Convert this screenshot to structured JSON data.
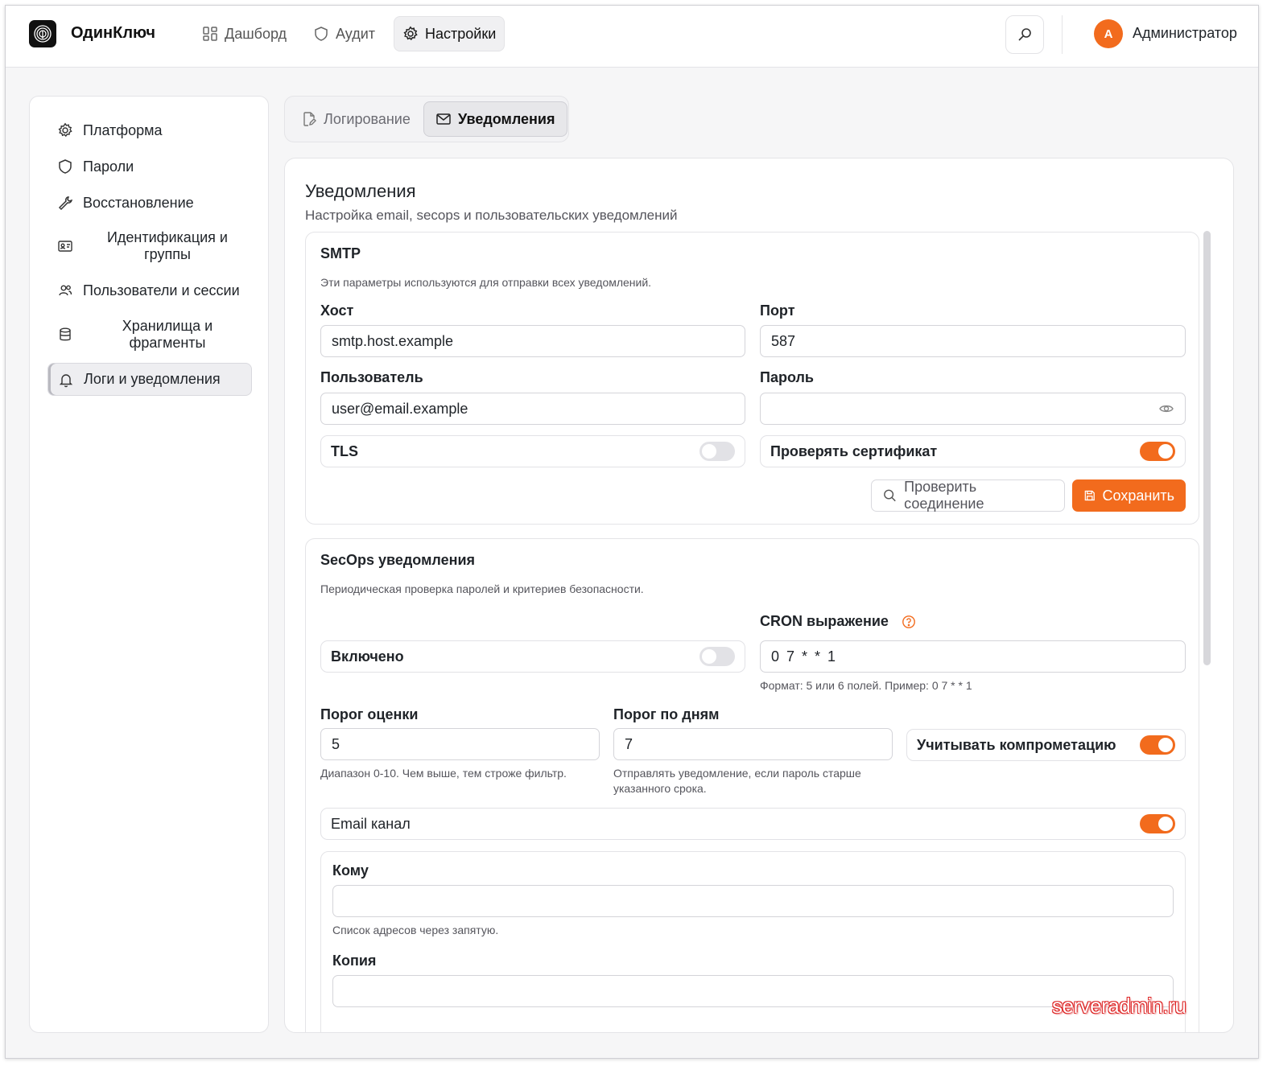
{
  "app": {
    "name": "ОдинКлюч",
    "nav": [
      {
        "label": "Дашборд",
        "icon": "dashboard-grid-icon"
      },
      {
        "label": "Аудит",
        "icon": "shield-icon"
      },
      {
        "label": "Настройки",
        "icon": "gear-icon",
        "active": true
      }
    ],
    "user": {
      "initial": "A",
      "name": "Администратор"
    }
  },
  "sidebar": {
    "items": [
      {
        "label": "Платформа",
        "icon": "gear-icon"
      },
      {
        "label": "Пароли",
        "icon": "shield-icon"
      },
      {
        "label": "Восстановление",
        "icon": "wrench-icon"
      },
      {
        "label": "Идентификация и группы",
        "icon": "id-card-icon"
      },
      {
        "label": "Пользователи и сессии",
        "icon": "users-icon"
      },
      {
        "label": "Хранилища и фрагменты",
        "icon": "database-icon"
      },
      {
        "label": "Логи и уведомления",
        "icon": "bell-icon",
        "active": true
      }
    ]
  },
  "tabs": [
    {
      "label": "Логирование",
      "icon": "file-edit-icon"
    },
    {
      "label": "Уведомления",
      "icon": "mail-icon",
      "active": true
    }
  ],
  "page": {
    "title": "Уведомления",
    "subtitle": "Настройка email, secops и пользовательских уведомлений"
  },
  "smtp": {
    "title": "SMTP",
    "description": "Эти параметры используются для отправки всех уведомлений.",
    "host_label": "Хост",
    "host_value": "smtp.host.example",
    "port_label": "Порт",
    "port_value": "587",
    "user_label": "Пользователь",
    "user_value": "user@email.example",
    "password_label": "Пароль",
    "password_value": "",
    "tls_label": "TLS",
    "tls_enabled": false,
    "verify_label": "Проверять сертификат",
    "verify_enabled": true,
    "test_button": "Проверить соединение",
    "save_button": "Сохранить"
  },
  "secops": {
    "title": "SecOps уведомления",
    "description": "Периодическая проверка паролей и критериев безопасности.",
    "enabled_label": "Включено",
    "enabled": false,
    "cron_label": "CRON выражение",
    "cron_value": "0 7 * * 1",
    "cron_hint": "Формат: 5 или 6 полей. Пример: 0 7 * * 1",
    "score_label": "Порог оценки",
    "score_value": "5",
    "score_hint": "Диапазон 0-10. Чем выше, тем строже фильтр.",
    "days_label": "Порог по дням",
    "days_value": "7",
    "days_hint": "Отправлять уведомление, если пароль старше указанного срока.",
    "compromise_label": "Учитывать компрометацию",
    "compromise_enabled": true,
    "email_channel_label": "Email канал",
    "email_channel_enabled": true,
    "to_label": "Кому",
    "to_value": "",
    "to_hint": "Список адресов через запятую.",
    "cc_label": "Копия",
    "cc_value": ""
  },
  "watermark": "serveradmin.ru",
  "colors": {
    "accent": "#f26b1d",
    "toggle_off": "#e2e2e6"
  }
}
